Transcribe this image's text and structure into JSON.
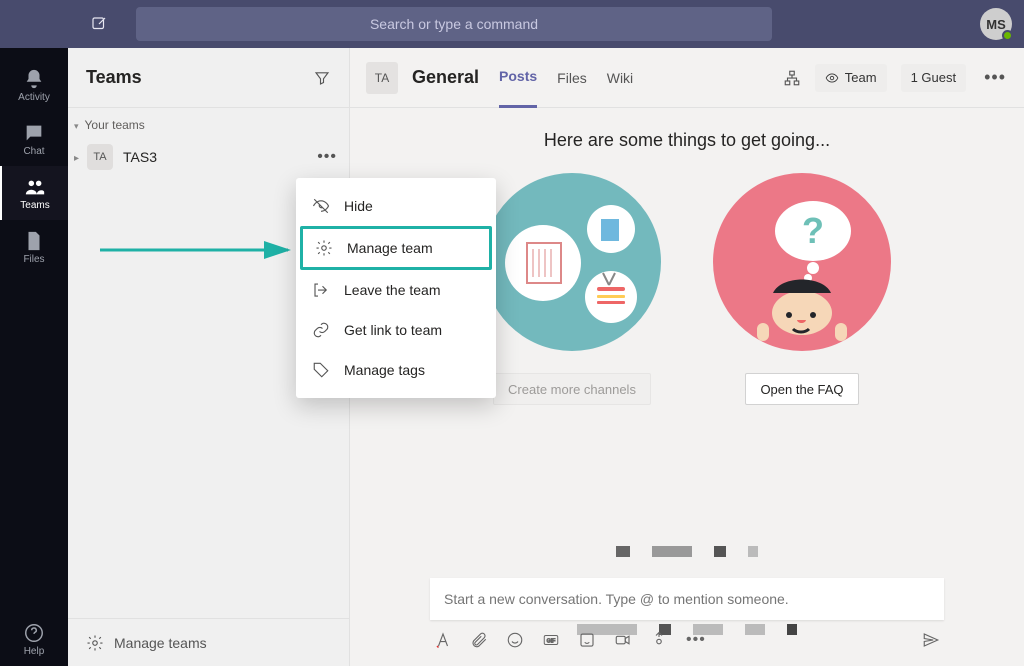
{
  "topbar": {
    "search_placeholder": "Search or type a command",
    "avatar_initials": "MS"
  },
  "rail": {
    "activity": "Activity",
    "chat": "Chat",
    "teams": "Teams",
    "files": "Files",
    "help": "Help"
  },
  "teams_col": {
    "title": "Teams",
    "your_teams": "Your teams",
    "team_badge": "TA",
    "team_name": "TAS3",
    "manage_teams": "Manage teams"
  },
  "ctx": {
    "hide": "Hide",
    "manage_team": "Manage team",
    "leave": "Leave the team",
    "get_link": "Get link to team",
    "manage_tags": "Manage tags"
  },
  "chan": {
    "badge": "TA",
    "name": "General",
    "tabs": {
      "posts": "Posts",
      "files": "Files",
      "wiki": "Wiki"
    },
    "visibility": "Team",
    "guest": "1 Guest"
  },
  "hero": {
    "title": "Here are some things to get going...",
    "create_channels": "Create more channels",
    "open_faq": "Open the FAQ"
  },
  "compose": {
    "placeholder": "Start a new conversation. Type @ to mention someone."
  }
}
